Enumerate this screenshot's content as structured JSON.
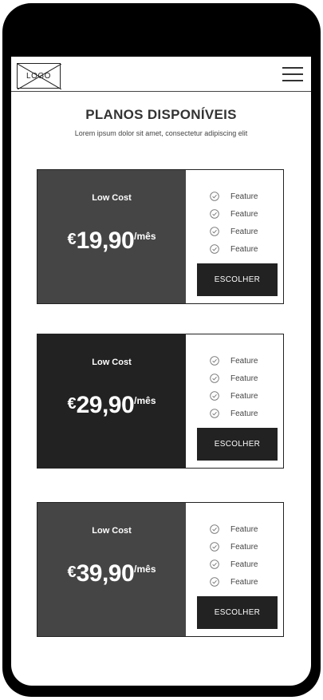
{
  "header": {
    "logo_text": "LOGO"
  },
  "section": {
    "title": "PLANOS DISPONÍVEIS",
    "subtitle": "Lorem ipsum dolor sit amet, consectetur adipiscing elit"
  },
  "plans": [
    {
      "name": "Low Cost",
      "currency": "€",
      "amount": "19,90",
      "period": "/mês",
      "features": [
        "Feature",
        "Feature",
        "Feature",
        "Feature"
      ],
      "button": "ESCOLHER",
      "color": "#454545"
    },
    {
      "name": "Low Cost",
      "currency": "€",
      "amount": "29,90",
      "period": "/mês",
      "features": [
        "Feature",
        "Feature",
        "Feature",
        "Feature"
      ],
      "button": "ESCOLHER",
      "color": "#222222"
    },
    {
      "name": "Low Cost",
      "currency": "€",
      "amount": "39,90",
      "period": "/mês",
      "features": [
        "Feature",
        "Feature",
        "Feature",
        "Feature"
      ],
      "button": "ESCOLHER",
      "color": "#454545"
    }
  ]
}
